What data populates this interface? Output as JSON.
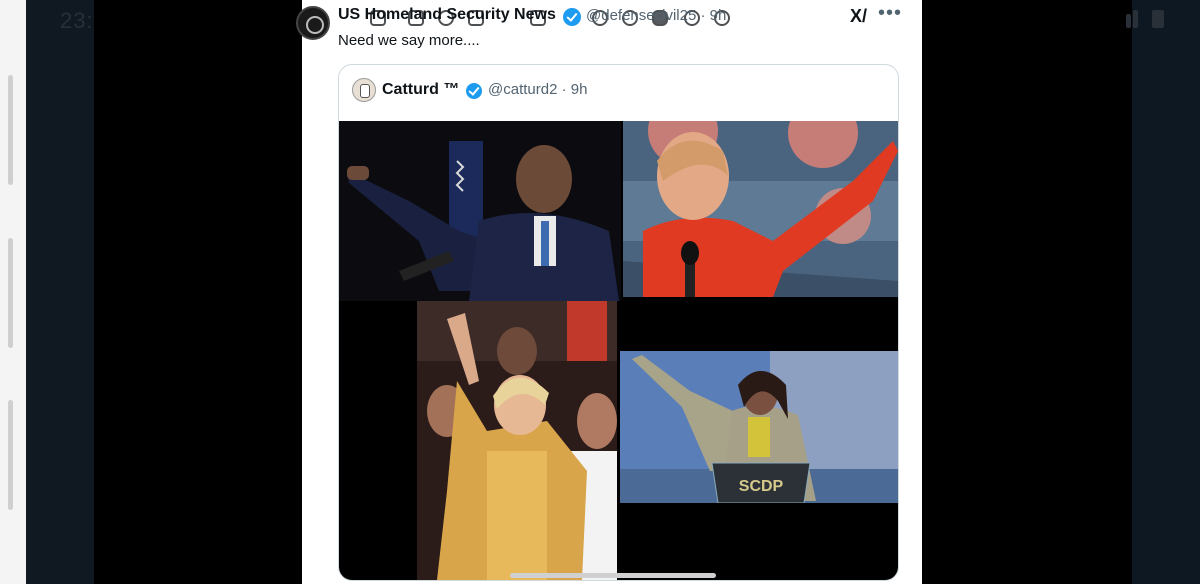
{
  "status_bar": {
    "time": "23:"
  },
  "tweet": {
    "author_name": "US Homeland Security News",
    "author_handle": "@defensecivil25 · 9h",
    "text": "Need we say more....",
    "grok_label": "X/",
    "more_label": "•••"
  },
  "quoted_tweet": {
    "author_name": "Catturd ™",
    "author_handle": "@catturd2 · 9h"
  },
  "collage_images": [
    {
      "label": "man in dark suit raising arm at podium"
    },
    {
      "label": "woman in red jacket raising arm"
    },
    {
      "label": "woman in yellow jacket raising arm in crowd"
    },
    {
      "label": "woman in grey suit raising arm at podium"
    }
  ],
  "podium_sign": "SCDP",
  "colors": {
    "accent": "#1d9bf0",
    "text": "#0f1419",
    "muted": "#536471",
    "border": "#cfd9de"
  }
}
